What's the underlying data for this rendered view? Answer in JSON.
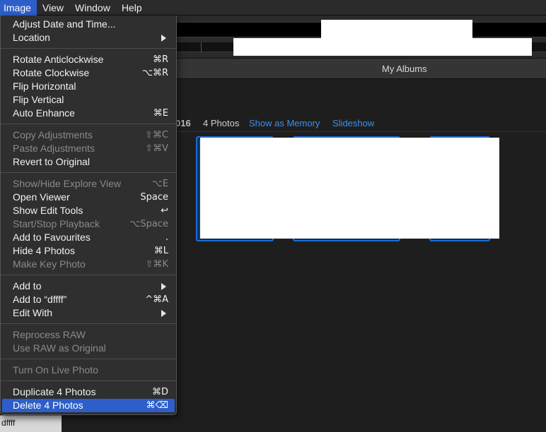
{
  "menubar": {
    "items": [
      "Image",
      "View",
      "Window",
      "Help"
    ],
    "active": "Image"
  },
  "window": {
    "title": "My Albums",
    "album": {
      "year_fragment": "016",
      "count": "4 Photos",
      "show_as_memory": "Show as Memory",
      "slideshow": "Slideshow"
    }
  },
  "status_text": "dffff",
  "menu": {
    "groups": [
      [
        {
          "label": "Adjust Date and Time...",
          "shortcut": "",
          "submenu": false,
          "enabled": true
        },
        {
          "label": "Location",
          "shortcut": "",
          "submenu": true,
          "enabled": true
        }
      ],
      [
        {
          "label": "Rotate Anticlockwise",
          "shortcut": "⌘R",
          "submenu": false,
          "enabled": true
        },
        {
          "label": "Rotate Clockwise",
          "shortcut": "⌥⌘R",
          "submenu": false,
          "enabled": true
        },
        {
          "label": "Flip Horizontal",
          "shortcut": "",
          "submenu": false,
          "enabled": true
        },
        {
          "label": "Flip Vertical",
          "shortcut": "",
          "submenu": false,
          "enabled": true
        },
        {
          "label": "Auto Enhance",
          "shortcut": "⌘E",
          "submenu": false,
          "enabled": true
        }
      ],
      [
        {
          "label": "Copy Adjustments",
          "shortcut": "⇧⌘C",
          "submenu": false,
          "enabled": false
        },
        {
          "label": "Paste Adjustments",
          "shortcut": "⇧⌘V",
          "submenu": false,
          "enabled": false
        },
        {
          "label": "Revert to Original",
          "shortcut": "",
          "submenu": false,
          "enabled": true
        }
      ],
      [
        {
          "label": "Show/Hide Explore View",
          "shortcut": "⌥E",
          "submenu": false,
          "enabled": false
        },
        {
          "label": "Open Viewer",
          "shortcut": "Space",
          "submenu": false,
          "enabled": true
        },
        {
          "label": "Show Edit Tools",
          "shortcut": "↩",
          "submenu": false,
          "enabled": true
        },
        {
          "label": "Start/Stop Playback",
          "shortcut": "⌥Space",
          "submenu": false,
          "enabled": false
        },
        {
          "label": "Add to Favourites",
          "shortcut": ".",
          "submenu": false,
          "enabled": true
        },
        {
          "label": "Hide 4 Photos",
          "shortcut": "⌘L",
          "submenu": false,
          "enabled": true
        },
        {
          "label": "Make Key Photo",
          "shortcut": "⇧⌘K",
          "submenu": false,
          "enabled": false
        }
      ],
      [
        {
          "label": "Add to",
          "shortcut": "",
          "submenu": true,
          "enabled": true
        },
        {
          "label": "Add to “dffff”",
          "shortcut": "^⌘A",
          "submenu": false,
          "enabled": true
        },
        {
          "label": "Edit With",
          "shortcut": "",
          "submenu": true,
          "enabled": true
        }
      ],
      [
        {
          "label": "Reprocess RAW",
          "shortcut": "",
          "submenu": false,
          "enabled": false
        },
        {
          "label": "Use RAW as Original",
          "shortcut": "",
          "submenu": false,
          "enabled": false
        }
      ],
      [
        {
          "label": "Turn On Live Photo",
          "shortcut": "",
          "submenu": false,
          "enabled": false
        }
      ],
      [
        {
          "label": "Duplicate 4 Photos",
          "shortcut": "⌘D",
          "submenu": false,
          "enabled": true
        },
        {
          "label": "Delete 4 Photos",
          "shortcut": "⌘⌫",
          "submenu": false,
          "enabled": true,
          "highlighted": true
        }
      ]
    ]
  },
  "colors": {
    "accent": "#2d5ec9",
    "link": "#3b8ff0",
    "selection_border": "#1a6fd8"
  }
}
